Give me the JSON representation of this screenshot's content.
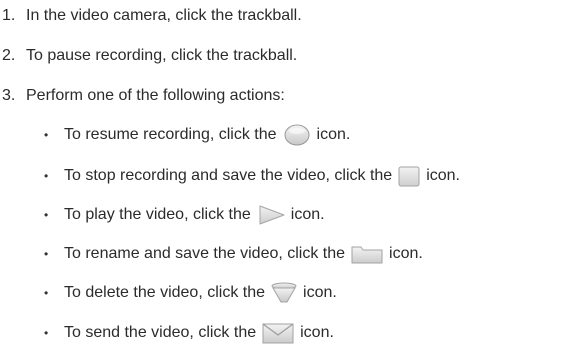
{
  "steps": [
    {
      "num": "1.",
      "text": "In the video camera, click the trackball."
    },
    {
      "num": "2.",
      "text": "To pause recording, click the trackball."
    },
    {
      "num": "3.",
      "text": "Perform one of the following actions:"
    }
  ],
  "actions": [
    {
      "pre": "To resume recording, click the",
      "icon": "record-icon",
      "post": "icon."
    },
    {
      "pre": "To stop recording and save the video, click the",
      "icon": "stop-icon",
      "post": "icon."
    },
    {
      "pre": "To play the video, click the",
      "icon": "play-icon",
      "post": "icon."
    },
    {
      "pre": "To rename and save the video, click the",
      "icon": "folder-icon",
      "post": "icon."
    },
    {
      "pre": "To delete the video, click the",
      "icon": "trash-icon",
      "post": "icon."
    },
    {
      "pre": "To send the video, click the",
      "icon": "envelope-icon",
      "post": "icon."
    }
  ],
  "bullet_char": "•"
}
